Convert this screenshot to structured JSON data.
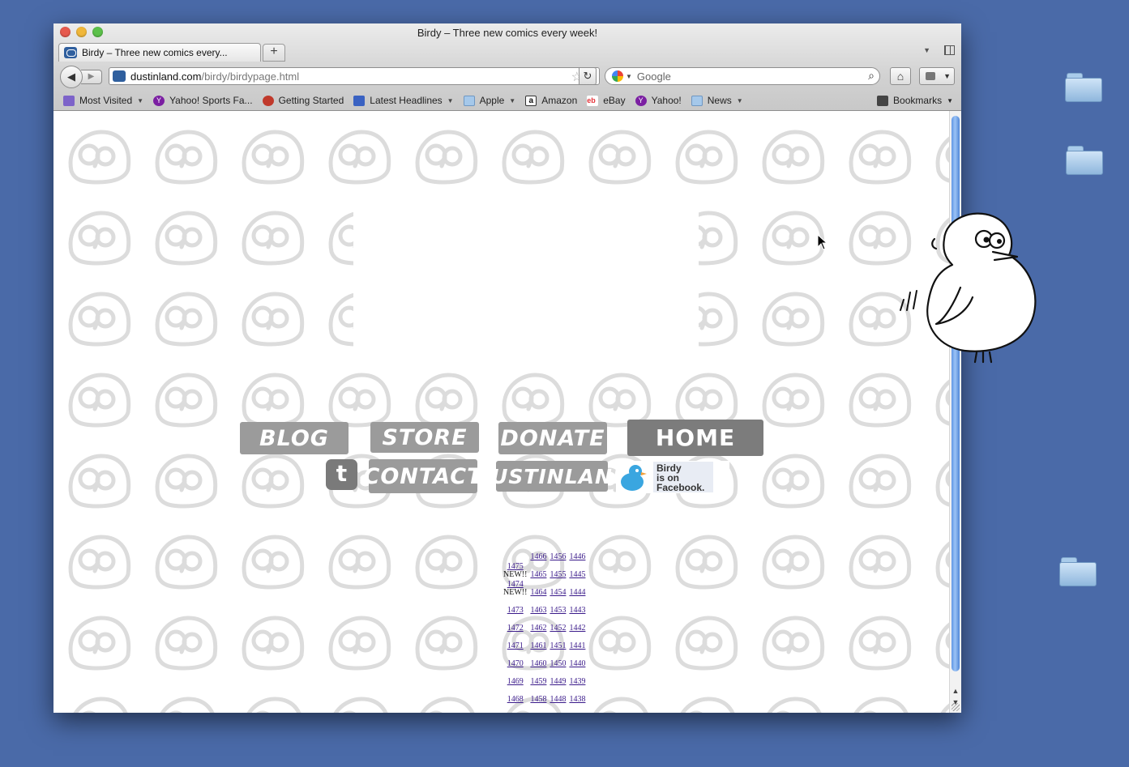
{
  "window": {
    "title": "Birdy – Three new comics every week!"
  },
  "tabs": [
    {
      "label": "Birdy – Three new comics every..."
    }
  ],
  "navigation": {
    "url_domain": "dustinland.com",
    "url_path": "/birdy/birdypage.html",
    "search_placeholder": "Google"
  },
  "bookmarks": {
    "items": [
      {
        "label": "Most Visited",
        "icon": "most-visited-icon",
        "menu": true
      },
      {
        "label": "Yahoo! Sports Fa...",
        "icon": "yahoo-icon",
        "menu": false
      },
      {
        "label": "Getting Started",
        "icon": "firefox-icon",
        "menu": false
      },
      {
        "label": "Latest Headlines",
        "icon": "rss-icon",
        "menu": true
      },
      {
        "label": "Apple",
        "icon": "folder-icon",
        "menu": true
      },
      {
        "label": "Amazon",
        "icon": "amazon-icon",
        "menu": false
      },
      {
        "label": "eBay",
        "icon": "ebay-icon",
        "menu": false
      },
      {
        "label": "Yahoo!",
        "icon": "yahoo-icon",
        "menu": false
      },
      {
        "label": "News",
        "icon": "folder-icon",
        "menu": true
      }
    ],
    "bookmarks_menu": "Bookmarks"
  },
  "site_nav": {
    "blog": "BLOG",
    "store": "STORE",
    "donate": "DONATE",
    "home": "HOME",
    "twitter": "t",
    "contact": "CONTACT",
    "dustinland": "DUSTINLAND",
    "facebook_lines": [
      "Birdy",
      "is on",
      "Facebook."
    ]
  },
  "comics": {
    "new_label": "NEW!!",
    "rows": [
      [
        {
          "n": "",
          "new": false
        },
        {
          "n": "1466"
        },
        {
          "n": "1456"
        },
        {
          "n": "1446"
        }
      ],
      [
        {
          "n": "1475",
          "new": true
        },
        {
          "n": "1465"
        },
        {
          "n": "1455"
        },
        {
          "n": "1445"
        }
      ],
      [
        {
          "n": "1474",
          "new": true
        },
        {
          "n": "1464"
        },
        {
          "n": "1454"
        },
        {
          "n": "1444"
        }
      ],
      [
        {
          "n": "1473"
        },
        {
          "n": "1463"
        },
        {
          "n": "1453"
        },
        {
          "n": "1443"
        }
      ],
      [
        {
          "n": "1472"
        },
        {
          "n": "1462"
        },
        {
          "n": "1452"
        },
        {
          "n": "1442"
        }
      ],
      [
        {
          "n": "1471"
        },
        {
          "n": "1461"
        },
        {
          "n": "1451"
        },
        {
          "n": "1441"
        }
      ],
      [
        {
          "n": "1470"
        },
        {
          "n": "1460"
        },
        {
          "n": "1450"
        },
        {
          "n": "1440"
        }
      ],
      [
        {
          "n": "1469"
        },
        {
          "n": "1459"
        },
        {
          "n": "1449"
        },
        {
          "n": "1439"
        }
      ],
      [
        {
          "n": "1468"
        },
        {
          "n": "1458"
        },
        {
          "n": "1448"
        },
        {
          "n": "1438"
        }
      ]
    ]
  },
  "colors": {
    "desktop": "#4a6aa8",
    "nav_button": "#9b9b9b",
    "home_button": "#7c7c7c",
    "link": "#3a1a8a"
  }
}
